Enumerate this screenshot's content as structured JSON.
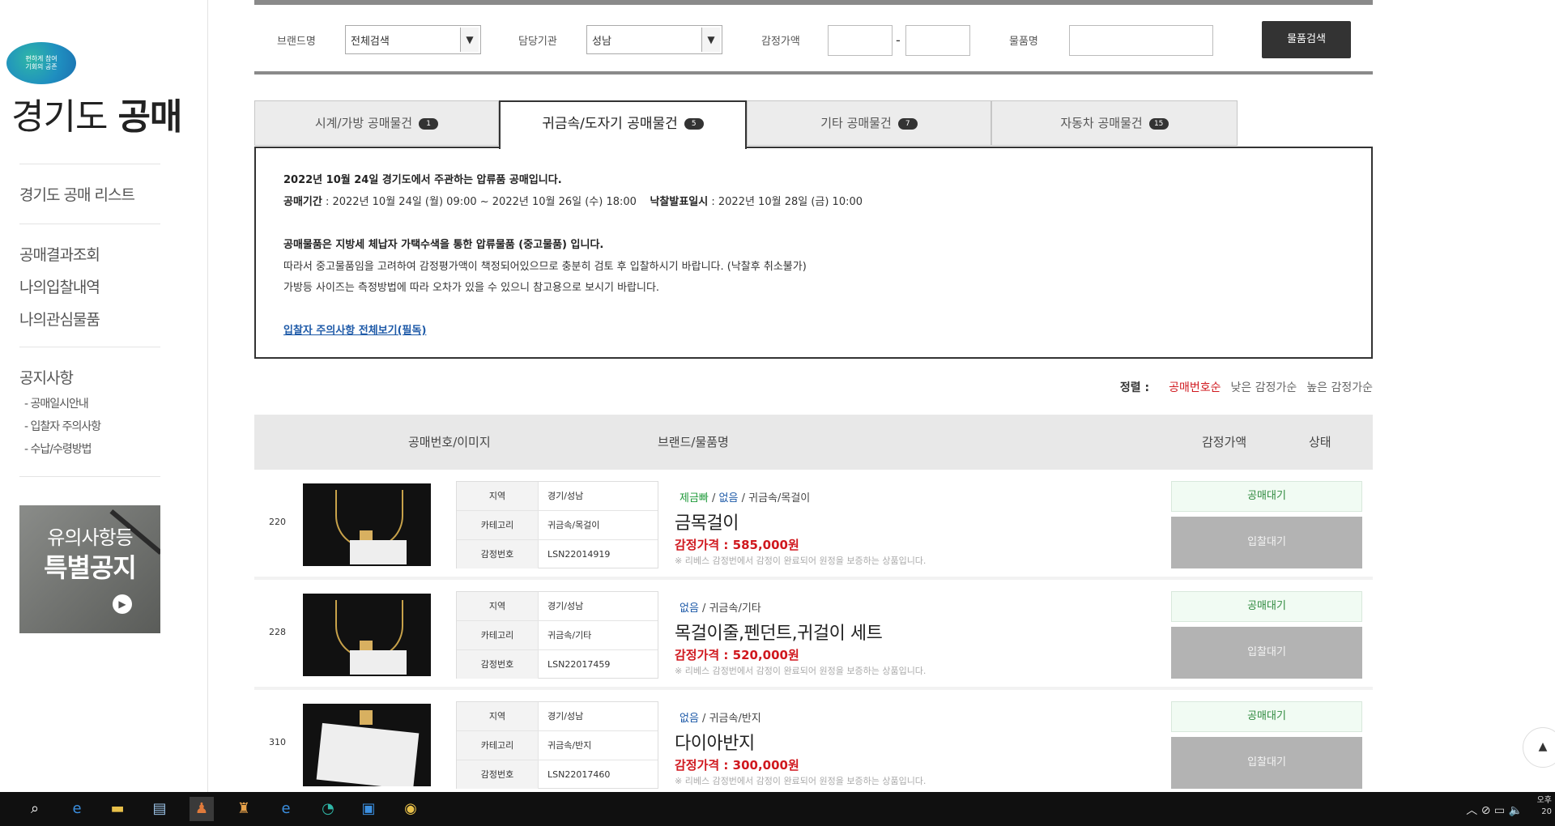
{
  "sidebar": {
    "badge_lines": [
      "편하게 참여",
      "기회의 공존"
    ],
    "logo_prefix": "경기도 ",
    "logo_bold": "공매",
    "menu1": "경기도 공매 리스트",
    "menu2": "공매결과조회",
    "menu3": "나의입찰내역",
    "menu4": "나의관심물품",
    "menu5": "공지사항",
    "sub1": "- 공매일시안내",
    "sub2": "- 입찰자 주의사항",
    "sub3": "- 수납/수령방법",
    "banner_line1": "유의사항등",
    "banner_line2": "특별공지"
  },
  "search": {
    "brand_label": "브랜드명",
    "brand_value": "전체검색",
    "agency_label": "담당기관",
    "agency_value": "성남",
    "price_label": "감정가액",
    "price_from": "",
    "price_to": "",
    "item_label": "물품명",
    "item_value": "",
    "button": "물품검색"
  },
  "tabs": [
    {
      "label": "시계/가방 공매물건",
      "count": "1"
    },
    {
      "label": "귀금속/도자기 공매물건",
      "count": "5"
    },
    {
      "label": "기타 공매물건",
      "count": "7"
    },
    {
      "label": "자동차 공매물건",
      "count": "15"
    }
  ],
  "notice": {
    "line1": "2022년 10월 24일 경기도에서 주관하는 압류품 공매입니다.",
    "period_label": "공매기간",
    "period_value": " : 2022년 10월 24일 (월) 09:00 ~ 2022년 10월 26일 (수) 18:00",
    "result_label": "낙찰발표일시",
    "result_value": " : 2022년 10월 28일 (금) 10:00",
    "line3": "공매물품은 지방세 체납자 가택수색을 통한 압류물품 (중고물품) 입니다.",
    "line4": "따라서 중고물품임을 고려하여 감정평가액이 책정되어있으므로 충분히 검토 후 입찰하시기 바랍니다. (낙찰후 취소불가)",
    "line5": "가방등 사이즈는 측정방법에 따라 오차가 있을 수 있으니 참고용으로 보시기 바랍니다.",
    "link": "입찰자 주의사항 전체보기(필독)"
  },
  "sort": {
    "label": "정렬 :",
    "opt1": "공매번호순",
    "opt2": "낮은 감정가순",
    "opt3": "높은 감정가순"
  },
  "table": {
    "h1": "공매번호/이미지",
    "h2": "브랜드/물품명",
    "h3": "감정가액",
    "h4": "상태"
  },
  "info_labels": {
    "region": "지역",
    "category": "카테고리",
    "appraisal_no": "감정번호"
  },
  "rows": [
    {
      "num": "220",
      "region": "경기/성남",
      "category": "귀금속/목걸이",
      "appraisal_no": "LSN22014919",
      "cat_prefix": "제금빠",
      "cat_brand": "없음",
      "cat_rest": " / 귀금속/목걸이",
      "title": "금목걸이",
      "price": "감정가격 : 585,000원",
      "note": "※ 리베스 감정번에서 감정이 완료되어 원정을 보증하는 상품입니다.",
      "status": "공매대기",
      "bid": "입찰대기"
    },
    {
      "num": "228",
      "region": "경기/성남",
      "category": "귀금속/기타",
      "appraisal_no": "LSN22017459",
      "cat_prefix": "",
      "cat_brand": "없음",
      "cat_rest": " / 귀금속/기타",
      "title": "목걸이줄,펜던트,귀걸이 세트",
      "price": "감정가격 : 520,000원",
      "note": "※ 리베스 감정번에서 감정이 완료되어 원정을 보증하는 상품입니다.",
      "status": "공매대기",
      "bid": "입찰대기"
    },
    {
      "num": "310",
      "region": "경기/성남",
      "category": "귀금속/반지",
      "appraisal_no": "LSN22017460",
      "cat_prefix": "",
      "cat_brand": "없음",
      "cat_rest": " / 귀금속/반지",
      "title": "다이아반지",
      "price": "감정가격 : 300,000원",
      "note": "※ 리베스 감정번에서 감정이 완료되어 원정을 보증하는 상품입니다.",
      "status": "공매대기",
      "bid": "입찰대기"
    }
  ],
  "taskbar": {
    "clock_line1": "오후",
    "clock_line2": "20"
  }
}
